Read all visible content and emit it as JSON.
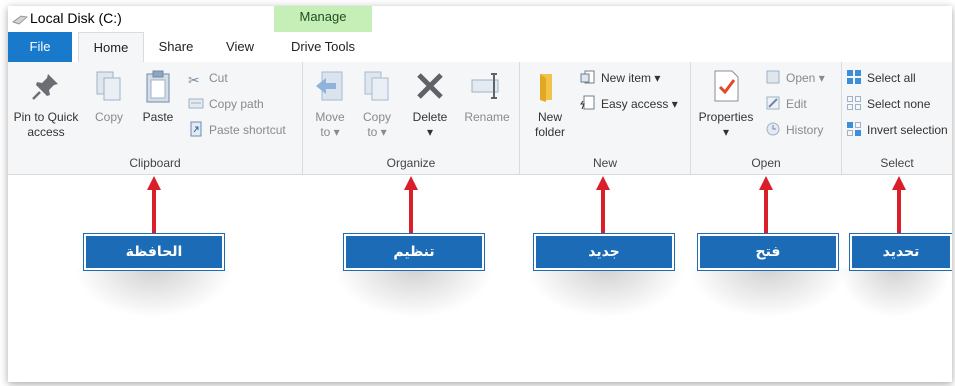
{
  "window": {
    "title": "Local Disk (C:)",
    "contextual_tab": "Manage"
  },
  "tabs": [
    "File",
    "Home",
    "Share",
    "View",
    "Drive Tools"
  ],
  "ribbon": {
    "clipboard": {
      "label": "Clipboard",
      "pin_line1": "Pin to Quick",
      "pin_line2": "access",
      "copy": "Copy",
      "paste": "Paste",
      "cut": "Cut",
      "copy_path": "Copy path",
      "paste_shortcut": "Paste shortcut"
    },
    "organize": {
      "label": "Organize",
      "move_line1": "Move",
      "move_line2": "to",
      "copy_line1": "Copy",
      "copy_line2": "to",
      "delete": "Delete",
      "rename": "Rename"
    },
    "new": {
      "label": "New",
      "folder_line1": "New",
      "folder_line2": "folder",
      "new_item": "New item",
      "easy_access": "Easy access"
    },
    "open": {
      "label": "Open",
      "properties": "Properties",
      "open": "Open",
      "edit": "Edit",
      "history": "History"
    },
    "select": {
      "label": "Select",
      "select_all": "Select all",
      "select_none": "Select none",
      "invert_selection": "Invert selection"
    }
  },
  "annotations": {
    "clipboard": "الحافظة",
    "organize": "تنظيم",
    "new": "جديد",
    "open": "فتح",
    "select": "تحديد"
  },
  "colors": {
    "file_tab": "#1979ca",
    "manage_tab": "#c6efb7",
    "label_bg": "#1c6bb7",
    "arrow": "#d9202a"
  }
}
